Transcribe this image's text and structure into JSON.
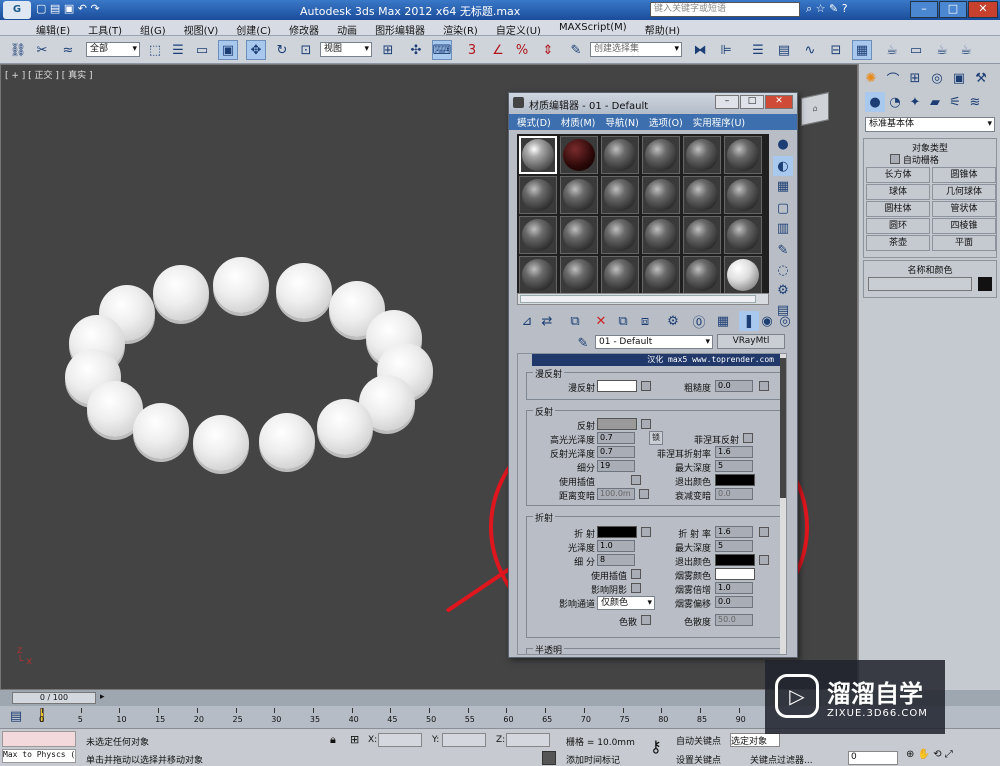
{
  "app": {
    "title": "Autodesk 3ds Max  2012 x64  无标题.max",
    "search_placeholder": "键入关键字或短语"
  },
  "menu": [
    "编辑(E)",
    "工具(T)",
    "组(G)",
    "视图(V)",
    "创建(C)",
    "修改器",
    "动画",
    "图形编辑器",
    "渲染(R)",
    "自定义(U)",
    "MAXScript(M)",
    "帮助(H)"
  ],
  "toolbar": {
    "filter": "全部",
    "view": "视图",
    "selection_set": "创建选择集"
  },
  "viewport": {
    "label": "[ + ] [ 正交 ] [ 真实 ]"
  },
  "cmd": {
    "category": "标准基本体",
    "object_type": "对象类型",
    "autogrid": "自动栅格",
    "buttons": [
      "长方体",
      "圆锥体",
      "球体",
      "几何球体",
      "圆柱体",
      "管状体",
      "圆环",
      "四棱锥",
      "茶壶",
      "平面"
    ],
    "name_color": "名称和颜色"
  },
  "mat_editor": {
    "title": "材质编辑器 - 01 - Default",
    "menu": [
      "模式(D)",
      "材质(M)",
      "导航(N)",
      "选项(O)",
      "实用程序(U)"
    ],
    "material_name": "01 - Default",
    "material_type": "VRayMtl",
    "banner": "汉化 max5 www.toprender.com",
    "diffuse": {
      "section": "漫反射",
      "diffuse": "漫反射",
      "roughness": "粗糙度",
      "roughness_val": "0.0"
    },
    "reflect": {
      "section": "反射",
      "reflect": "反射",
      "hilight_gloss": "高光光泽度",
      "hilight_val": "0.7",
      "lock": "锁",
      "fresnel": "菲涅耳反射",
      "refl_gloss": "反射光泽度",
      "refl_val": "0.7",
      "fresnel_ior": "菲涅耳折射率",
      "fresnel_ior_val": "1.6",
      "subdivs": "细分",
      "subdivs_val": "19",
      "max_depth": "最大深度",
      "max_depth_val": "5",
      "use_interp": "使用插值",
      "exit_color": "退出颜色",
      "dim_dist": "距离变暗",
      "dim_val": "100.0m",
      "dim_falloff": "衰减变暗",
      "dim_falloff_val": "0.0"
    },
    "refract": {
      "section": "折射",
      "refract": "折 射",
      "ior": "折 射 率",
      "ior_val": "1.6",
      "gloss": "光泽度",
      "gloss_val": "1.0",
      "max_depth": "最大深度",
      "max_depth_val": "5",
      "subdivs": "细 分",
      "subdivs_val": "8",
      "exit_color": "退出颜色",
      "use_interp": "使用插值",
      "fog_color": "烟雾颜色",
      "shadows": "影响阴影",
      "fog_mult": "烟雾倍增",
      "fog_mult_val": "1.0",
      "channels": "影响通道",
      "channels_val": "仅颜色",
      "fog_bias": "烟雾偏移",
      "fog_bias_val": "0.0",
      "dispersion": "色散",
      "abbe": "色散度",
      "abbe_val": "50.0"
    },
    "translucency": "半透明"
  },
  "timeline": {
    "frame": "0 / 100",
    "ticks": [
      "0",
      "5",
      "10",
      "15",
      "20",
      "25",
      "30",
      "35",
      "40",
      "45",
      "50",
      "55",
      "60",
      "65",
      "70",
      "75",
      "80",
      "85",
      "90"
    ]
  },
  "status": {
    "script": "Max to Physcs (",
    "selection": "未选定任何对象",
    "hint": "单击并拖动以选择并移动对象",
    "x": "X:",
    "y": "Y:",
    "z": "Z:",
    "grid": "栅格 = 10.0mm",
    "add_time_tag": "添加时间标记",
    "autokey": "自动关键点",
    "selected": "选定对象",
    "setkey": "设置关键点",
    "key_filter": "关键点过滤器...",
    "frame_val": "0"
  },
  "watermark": {
    "brand": "溜溜自学",
    "url": "ZIXUE.3D66.COM"
  },
  "colors": {
    "accent": "#e0161e",
    "title_blue": "#1f5bb0"
  }
}
